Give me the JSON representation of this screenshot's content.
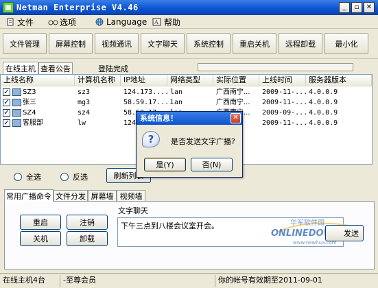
{
  "window": {
    "title": "Netman Enterprise V4.46"
  },
  "menu": [
    {
      "label": "文件",
      "icon": "document-icon"
    },
    {
      "label": "选项",
      "icon": "glasses-icon"
    },
    {
      "label": "Language",
      "icon": "globe-icon"
    },
    {
      "label": "帮助",
      "icon": "help-book-icon"
    }
  ],
  "toolbar": [
    "文件管理",
    "屏幕控制",
    "视频通讯",
    "文字聊天",
    "系统控制",
    "重启关机",
    "远程卸载",
    "最小化"
  ],
  "top_tabs": [
    "在线主机",
    "查看公告"
  ],
  "status": {
    "message": "登陆完成"
  },
  "host_list": {
    "columns": [
      "上线名称",
      "计算机名称",
      "IP地址",
      "网络类型",
      "实际位置",
      "上线时间",
      "服务器版本"
    ],
    "rows": [
      {
        "checked": "✓",
        "name": "SZ3",
        "computer": "sz3",
        "ip": "124.173....",
        "net": "lan",
        "location": "广西南宁...",
        "time": "2009-11-...",
        "version": "4.0.0.9"
      },
      {
        "checked": "✓",
        "name": "张三",
        "computer": "mg3",
        "ip": "58.59.17....",
        "net": "lan",
        "location": "广西南宁...",
        "time": "2009-11-...",
        "version": "4.0.0.9"
      },
      {
        "checked": "✓",
        "name": "SZ4",
        "computer": "sz4",
        "ip": "58.59.17....",
        "net": "lan",
        "location": "广西南宁...",
        "time": "2009-09-...",
        "version": "4.0.0.9"
      },
      {
        "checked": "✓",
        "name": "客服部",
        "computer": "lw",
        "ip": "124...",
        "net": "",
        "location": "",
        "time": "2009-11-...",
        "version": "4.0.0.9"
      }
    ]
  },
  "selection": {
    "select_all": "全选",
    "invert": "反选",
    "refresh": "刷新列表"
  },
  "bottom_tabs": [
    "常用广播命令",
    "文件分发",
    "屏幕墙",
    "视频墙"
  ],
  "broadcast": {
    "restart": "重启",
    "logout": "注销",
    "shutdown": "关机",
    "uninstall": "卸载",
    "chat_label": "文字聊天",
    "chat_text": "下午三点到八楼会议室开会。",
    "send": "发送"
  },
  "statusbar": {
    "hosts": "在线主机4台",
    "member": "-至尊会员",
    "expiry": "你的帐号有效期至2011-09-01"
  },
  "dialog": {
    "title": "系统信息！",
    "message": "是否发送文字广播?",
    "yes": "是(Y)",
    "no": "否(N)",
    "icon": "question-icon"
  },
  "watermark": {
    "cn": "华军软件园",
    "brand": "ONLINEDOWN",
    "url": "www.newhua.com"
  },
  "colors": {
    "title_blue": "#0b53d0",
    "face": "#ece9d8"
  }
}
